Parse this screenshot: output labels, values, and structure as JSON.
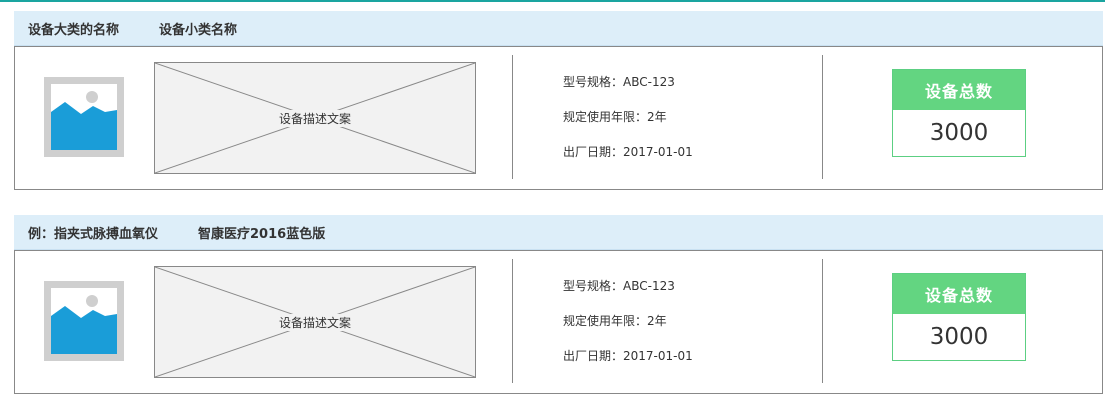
{
  "cards": [
    {
      "category": "设备大类的名称",
      "subcategory": "设备小类名称",
      "description": "设备描述文案",
      "spec_model": "型号规格：ABC-123",
      "spec_life": "规定使用年限：2年",
      "spec_date": "出厂日期：2017-01-01",
      "total_label": "设备总数",
      "total_value": "3000"
    },
    {
      "category": "例：指夹式脉搏血氧仪",
      "subcategory": "智康医疗2016蓝色版",
      "description": "设备描述文案",
      "spec_model": "型号规格：ABC-123",
      "spec_life": "规定使用年限：2年",
      "spec_date": "出厂日期：2017-01-01",
      "total_label": "设备总数",
      "total_value": "3000"
    }
  ],
  "colors": {
    "accent_rule": "#1aa5a0",
    "header_bg": "#ddeef9",
    "count_header": "#63d581",
    "image_blue": "#1a9dd8"
  },
  "icons": {
    "thumbnail": "image-placeholder-icon"
  }
}
